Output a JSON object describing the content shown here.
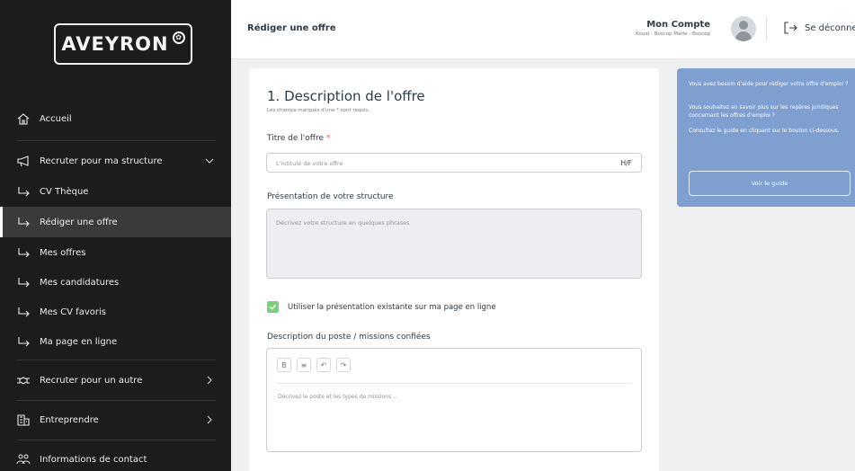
{
  "sidebar": {
    "logo": "AVEYRON",
    "items": [
      {
        "label": "Accueil",
        "icon": "home-icon"
      },
      {
        "label": "Recruter pour ma structure",
        "icon": "megaphone-icon",
        "arrow": "chevron-down-icon"
      },
      {
        "label": "CV Thèque",
        "icon": "sub-arrow-icon"
      },
      {
        "label": "Rédiger une offre",
        "icon": "sub-arrow-icon",
        "active": true
      },
      {
        "label": "Mes offres",
        "icon": "sub-arrow-icon"
      },
      {
        "label": "Mes candidatures",
        "icon": "sub-arrow-icon"
      },
      {
        "label": "Mes CV favoris",
        "icon": "sub-arrow-icon"
      },
      {
        "label": "Ma page en ligne",
        "icon": "sub-arrow-icon"
      },
      {
        "label": "Recruter pour un autre",
        "icon": "handshake-icon",
        "arrow": "chevron-right-icon"
      },
      {
        "label": "Entreprendre",
        "icon": "building-icon",
        "arrow": "chevron-right-icon"
      },
      {
        "label": "Informations de contact",
        "icon": "contacts-icon"
      }
    ]
  },
  "header": {
    "title": "Rédiger une offre",
    "account_name": "Mon Compte",
    "account_sub": "Koual - Boscop Marie - Boscop",
    "logout": "Se déconnecter"
  },
  "form": {
    "section_title": "1. Description de l'offre",
    "required_note_prefix": "Les champs marqués d'une ",
    "required_star": "*",
    "required_note_suffix": " sont requis.",
    "title_label": "Titre de l'offre",
    "title_placeholder": "L'intitulé de votre offre",
    "title_suffix": "H/F",
    "presentation_label": "Présentation de votre structure",
    "presentation_placeholder": "Décrivez votre structure en quelques phrases",
    "checkbox_label": "Utiliser la présentation existante sur ma page en ligne",
    "checkbox_checked": true,
    "description_label": "Description du poste / missions confiées",
    "toolbar": [
      "B",
      "≡",
      "↶",
      "↷"
    ],
    "description_placeholder": "Décrivez le poste et les types de missions ..."
  },
  "help": {
    "line1": "Vous avez besoin d'aide pour rédiger votre offre d'emploi ?",
    "line2": "Vous souhaitez en savoir plus sur les repères juridiques concernant les offres d'emploi ?",
    "line3": "Consultez le guide en cliquant sur le bouton ci-dessous.",
    "button": "Voir le guide"
  },
  "colors": {
    "sidebar_bg": "#1c1c1c",
    "active_bg": "#3a3a3a",
    "help_bg": "#7e9fcf",
    "checkbox": "#7ccf7a",
    "required": "#e25656"
  }
}
